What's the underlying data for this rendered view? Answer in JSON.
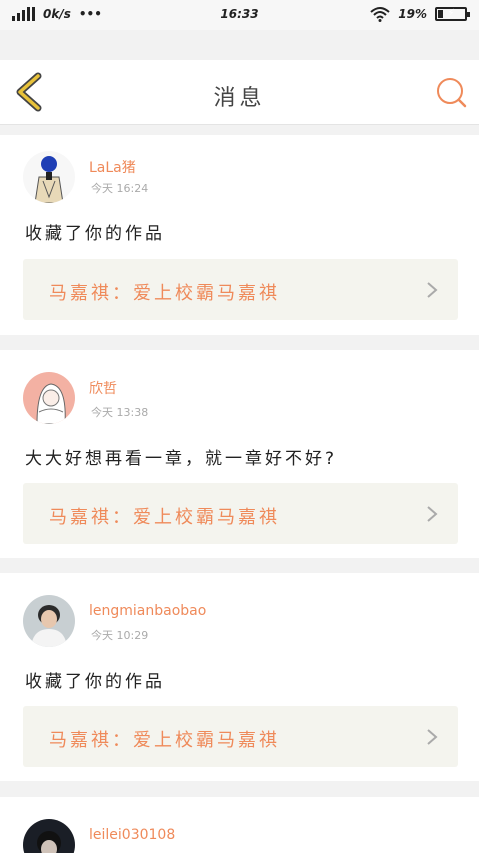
{
  "statusbar": {
    "network_speed": "0k/s",
    "dots": "•••",
    "time": "16:33",
    "battery_percent": "19%",
    "battery_level": 0.19
  },
  "navbar": {
    "title": "消息",
    "back_icon": "chevron-left-icon",
    "search_icon": "search-icon"
  },
  "colors": {
    "accent": "#ef8a5a",
    "back_icon": "#e8c23a",
    "ref_bg": "#f4f4ee"
  },
  "messages": [
    {
      "username": "LaLa猪",
      "time": "今天 16:24",
      "text": "收藏了你的作品",
      "ref": "马嘉祺：爱上校霸马嘉祺"
    },
    {
      "username": "欣哲",
      "time": "今天 13:38",
      "text": "大大好想再看一章，就一章好不好?",
      "ref": "马嘉祺：爱上校霸马嘉祺"
    },
    {
      "username": "lengmianbaobao",
      "time": "今天 10:29",
      "text": "收藏了你的作品",
      "ref": "马嘉祺：爱上校霸马嘉祺"
    },
    {
      "username": "leilei030108"
    }
  ]
}
